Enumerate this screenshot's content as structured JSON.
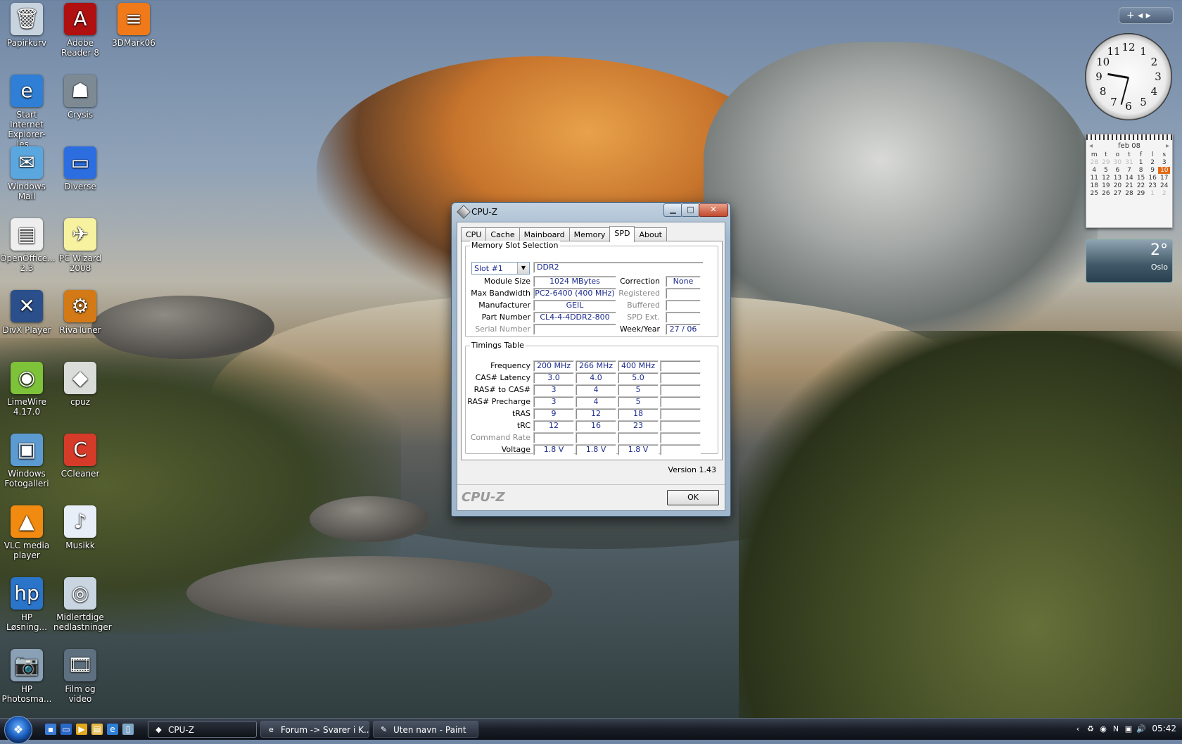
{
  "desktop": {
    "icons": [
      {
        "label": "Papirkurv",
        "glyph": "🗑",
        "bg": "#c7d3de"
      },
      {
        "label": "Adobe Reader 8",
        "glyph": "A",
        "bg": "#b01010"
      },
      {
        "label": "3DMark06",
        "glyph": "≡",
        "bg": "#f07a1a"
      },
      {
        "label": "Start Internet Explorer-les...",
        "glyph": "e",
        "bg": "#2f7fd6"
      },
      {
        "label": "Crysis",
        "glyph": "☗",
        "bg": "#7d8a94"
      },
      {
        "label": "Windows Mail",
        "glyph": "✉",
        "bg": "#5aa7e0"
      },
      {
        "label": "Diverse",
        "glyph": "▭",
        "bg": "#2c6ee0"
      },
      {
        "label": "OpenOffice... 2.3",
        "glyph": "▤",
        "bg": "#eeeeee"
      },
      {
        "label": "PC Wizard 2008",
        "glyph": "✈",
        "bg": "#f6f2a0"
      },
      {
        "label": "DivX Player",
        "glyph": "✕",
        "bg": "#2a4f8a"
      },
      {
        "label": "RivaTuner",
        "glyph": "⚙",
        "bg": "#d37a16"
      },
      {
        "label": "LimeWire 4.17.0",
        "glyph": "◉",
        "bg": "#7ec23a"
      },
      {
        "label": "cpuz",
        "glyph": "◆",
        "bg": "#d9dcd9"
      },
      {
        "label": "Windows Fotogalleri",
        "glyph": "▣",
        "bg": "#5c9bd2"
      },
      {
        "label": "CCleaner",
        "glyph": "C",
        "bg": "#d63b2a"
      },
      {
        "label": "VLC media player",
        "glyph": "▲",
        "bg": "#f08a10"
      },
      {
        "label": "Musikk",
        "glyph": "♪",
        "bg": "#e8eef7"
      },
      {
        "label": "HP Løsning...",
        "glyph": "hp",
        "bg": "#2a74c9"
      },
      {
        "label": "Midlertdige nedlastninger",
        "glyph": "◎",
        "bg": "#c9d6e2"
      },
      {
        "label": "HP Photosma...",
        "glyph": "📷",
        "bg": "#8aa0b5"
      },
      {
        "label": "Film og video",
        "glyph": "🎞",
        "bg": "#5e7080"
      }
    ],
    "shortcut_arrow": "↗"
  },
  "gadgets": {
    "controls": "+ ◂ ▸",
    "clock_numbers": [
      "12",
      "1",
      "2",
      "3",
      "4",
      "5",
      "6",
      "7",
      "8",
      "9",
      "10",
      "11"
    ],
    "calendar": {
      "month": "feb 08",
      "weekdays": [
        "m",
        "t",
        "o",
        "t",
        "f",
        "l",
        "s"
      ],
      "days": [
        {
          "d": "28",
          "dim": true
        },
        {
          "d": "29",
          "dim": true
        },
        {
          "d": "30",
          "dim": true
        },
        {
          "d": "31",
          "dim": true
        },
        {
          "d": "1"
        },
        {
          "d": "2"
        },
        {
          "d": "3"
        },
        {
          "d": "4"
        },
        {
          "d": "5"
        },
        {
          "d": "6"
        },
        {
          "d": "7"
        },
        {
          "d": "8"
        },
        {
          "d": "9"
        },
        {
          "d": "10",
          "today": true
        },
        {
          "d": "11"
        },
        {
          "d": "12"
        },
        {
          "d": "13"
        },
        {
          "d": "14"
        },
        {
          "d": "15"
        },
        {
          "d": "16"
        },
        {
          "d": "17"
        },
        {
          "d": "18"
        },
        {
          "d": "19"
        },
        {
          "d": "20"
        },
        {
          "d": "21"
        },
        {
          "d": "22"
        },
        {
          "d": "23"
        },
        {
          "d": "24"
        },
        {
          "d": "25"
        },
        {
          "d": "26"
        },
        {
          "d": "27"
        },
        {
          "d": "28"
        },
        {
          "d": "29"
        },
        {
          "d": "1",
          "dim": true
        },
        {
          "d": "2",
          "dim": true
        }
      ]
    },
    "weather": {
      "temp": "2°",
      "city": "Oslo"
    }
  },
  "cpuz": {
    "title": "CPU-Z",
    "tabs": [
      "CPU",
      "Cache",
      "Mainboard",
      "Memory",
      "SPD",
      "About"
    ],
    "active_tab": "SPD",
    "memory_slot_selection": {
      "legend": "Memory Slot Selection",
      "slot": "Slot #1",
      "type": "DDR2",
      "module_size_label": "Module Size",
      "module_size": "1024 MBytes",
      "max_bandwidth_label": "Max Bandwidth",
      "max_bandwidth": "PC2-6400 (400 MHz)",
      "manufacturer_label": "Manufacturer",
      "manufacturer": "GEIL",
      "part_number_label": "Part Number",
      "part_number": "CL4-4-4DDR2-800",
      "serial_number_label": "Serial Number",
      "serial_number": "",
      "correction_label": "Correction",
      "correction": "None",
      "registered_label": "Registered",
      "registered": "",
      "buffered_label": "Buffered",
      "buffered": "",
      "spd_ext_label": "SPD Ext.",
      "spd_ext": "",
      "week_year_label": "Week/Year",
      "week_year": "27 / 06"
    },
    "timings": {
      "legend": "Timings Table",
      "rows": [
        {
          "label": "Frequency",
          "values": [
            "200 MHz",
            "266 MHz",
            "400 MHz",
            ""
          ],
          "disabled": false
        },
        {
          "label": "CAS# Latency",
          "values": [
            "3.0",
            "4.0",
            "5.0",
            ""
          ],
          "disabled": false
        },
        {
          "label": "RAS# to CAS#",
          "values": [
            "3",
            "4",
            "5",
            ""
          ],
          "disabled": false
        },
        {
          "label": "RAS# Precharge",
          "values": [
            "3",
            "4",
            "5",
            ""
          ],
          "disabled": false
        },
        {
          "label": "tRAS",
          "values": [
            "9",
            "12",
            "18",
            ""
          ],
          "disabled": false
        },
        {
          "label": "tRC",
          "values": [
            "12",
            "16",
            "23",
            ""
          ],
          "disabled": false
        },
        {
          "label": "Command Rate",
          "values": [
            "",
            "",
            "",
            ""
          ],
          "disabled": true
        },
        {
          "label": "Voltage",
          "values": [
            "1.8 V",
            "1.8 V",
            "1.8 V",
            ""
          ],
          "disabled": false
        }
      ]
    },
    "version": "Version 1.43",
    "brand": "CPU-Z",
    "ok": "OK",
    "minimize": "▁",
    "maximize": "□",
    "close": "✕",
    "dropdown_arrow": "▼"
  },
  "taskbar": {
    "start_glyph": "❖",
    "quicklaunch": [
      {
        "glyph": "▪",
        "color": "#3a7bd5"
      },
      {
        "glyph": "▭",
        "color": "#2a68c8"
      },
      {
        "glyph": "▶",
        "color": "#e2a81c"
      },
      {
        "glyph": "▤",
        "color": "#e3b84a"
      },
      {
        "glyph": "e",
        "color": "#2f7fd6"
      },
      {
        "glyph": "▯",
        "color": "#7fa6c6"
      }
    ],
    "tasks": [
      {
        "label": "CPU-Z",
        "glyph": "◆",
        "active": true
      },
      {
        "label": "Forum -> Svarer i K...",
        "glyph": "e",
        "active": false
      },
      {
        "label": "Uten navn - Paint",
        "glyph": "✎",
        "active": false
      }
    ],
    "tray": [
      "‹",
      "♻",
      "◉",
      "N",
      "▣",
      "🔊"
    ],
    "time": "05:42"
  }
}
